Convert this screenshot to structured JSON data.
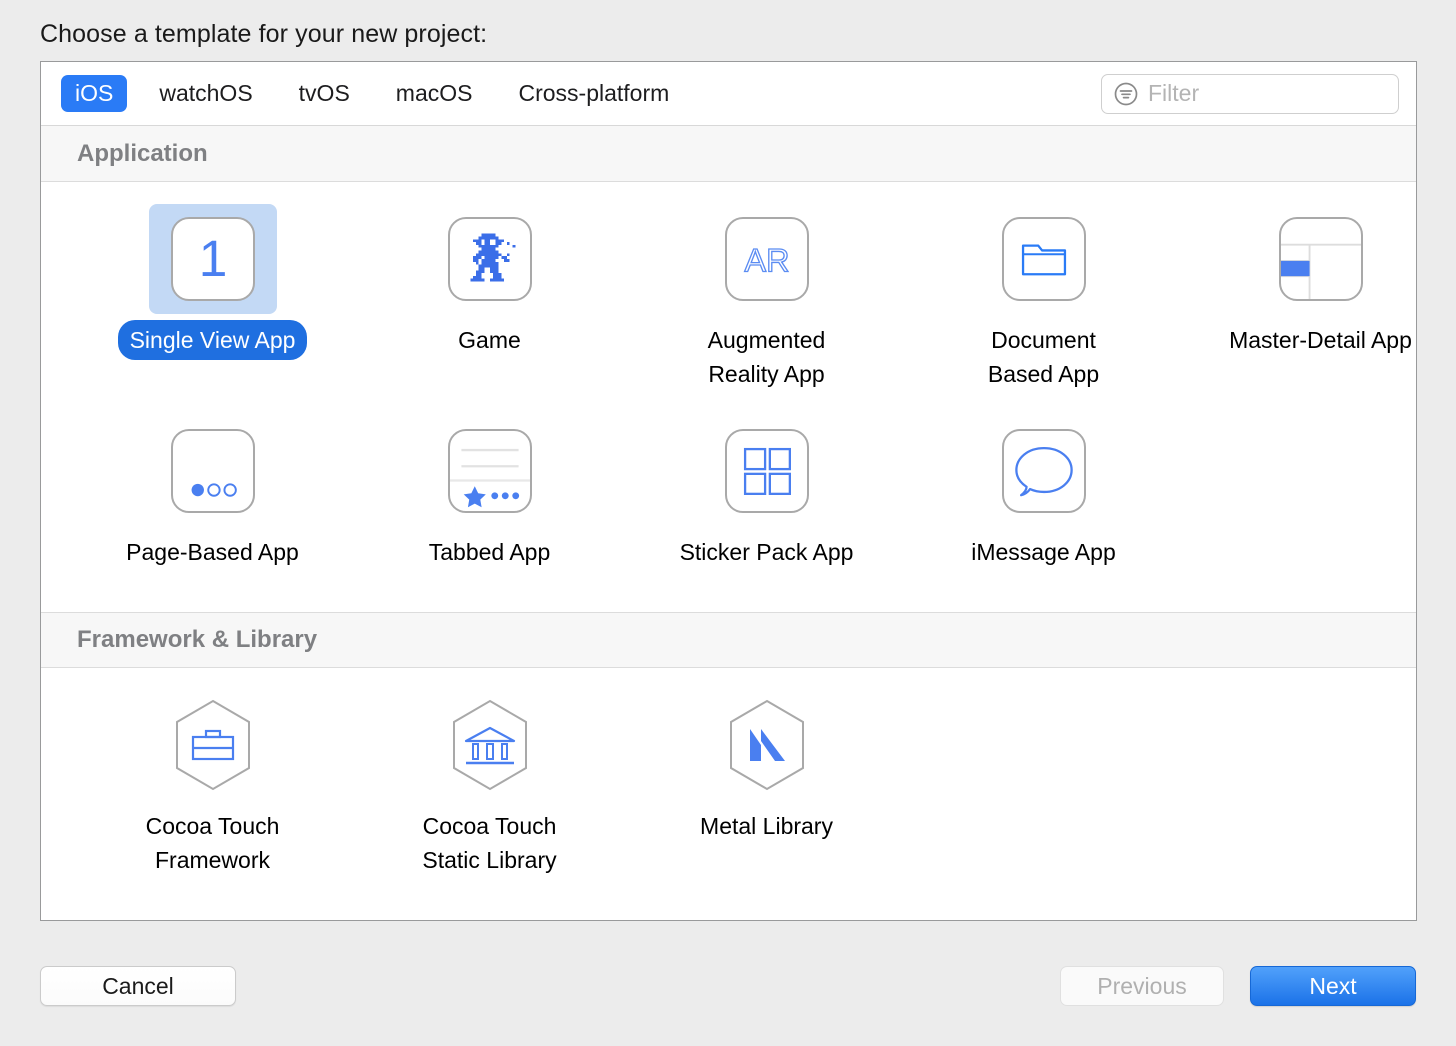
{
  "prompt": "Choose a template for your new project:",
  "toolbar": {
    "platforms": [
      {
        "label": "iOS",
        "selected": true
      },
      {
        "label": "watchOS",
        "selected": false
      },
      {
        "label": "tvOS",
        "selected": false
      },
      {
        "label": "macOS",
        "selected": false
      },
      {
        "label": "Cross-platform",
        "selected": false
      }
    ],
    "filter": {
      "placeholder": "Filter",
      "value": "",
      "icon": "filter-icon"
    }
  },
  "sections": [
    {
      "title": "Application",
      "rows": [
        [
          {
            "label": "Single View App",
            "icon": "single-view-icon",
            "selected": true
          },
          {
            "label": "Game",
            "icon": "game-icon",
            "selected": false
          },
          {
            "label": "Augmented\nReality App",
            "icon": "augmented-reality-icon",
            "selected": false
          },
          {
            "label": "Document\nBased App",
            "icon": "document-folder-icon",
            "selected": false
          },
          {
            "label": "Master-Detail App",
            "icon": "master-detail-icon",
            "selected": false
          }
        ],
        [
          {
            "label": "Page-Based App",
            "icon": "page-based-icon",
            "selected": false
          },
          {
            "label": "Tabbed App",
            "icon": "tabbed-app-icon",
            "selected": false
          },
          {
            "label": "Sticker Pack App",
            "icon": "sticker-pack-icon",
            "selected": false
          },
          {
            "label": "iMessage App",
            "icon": "imessage-bubble-icon",
            "selected": false
          }
        ]
      ]
    },
    {
      "title": "Framework & Library",
      "rows": [
        [
          {
            "label": "Cocoa Touch\nFramework",
            "icon": "briefcase-hex-icon",
            "selected": false
          },
          {
            "label": "Cocoa Touch\nStatic Library",
            "icon": "bank-hex-icon",
            "selected": false
          },
          {
            "label": "Metal Library",
            "icon": "metal-hex-icon",
            "selected": false
          }
        ]
      ]
    }
  ],
  "footer": {
    "cancel_label": "Cancel",
    "previous_label": "Previous",
    "next_label": "Next"
  },
  "colors": {
    "accent_blue": "#2a7bf6",
    "icon_blue": "#4a7ff0",
    "selection_fill": "#c3d9f5",
    "selected_pill": "#1f6fe0",
    "window_background": "#ececec",
    "panel_background": "#ffffff",
    "section_header_text": "#7f8083"
  }
}
